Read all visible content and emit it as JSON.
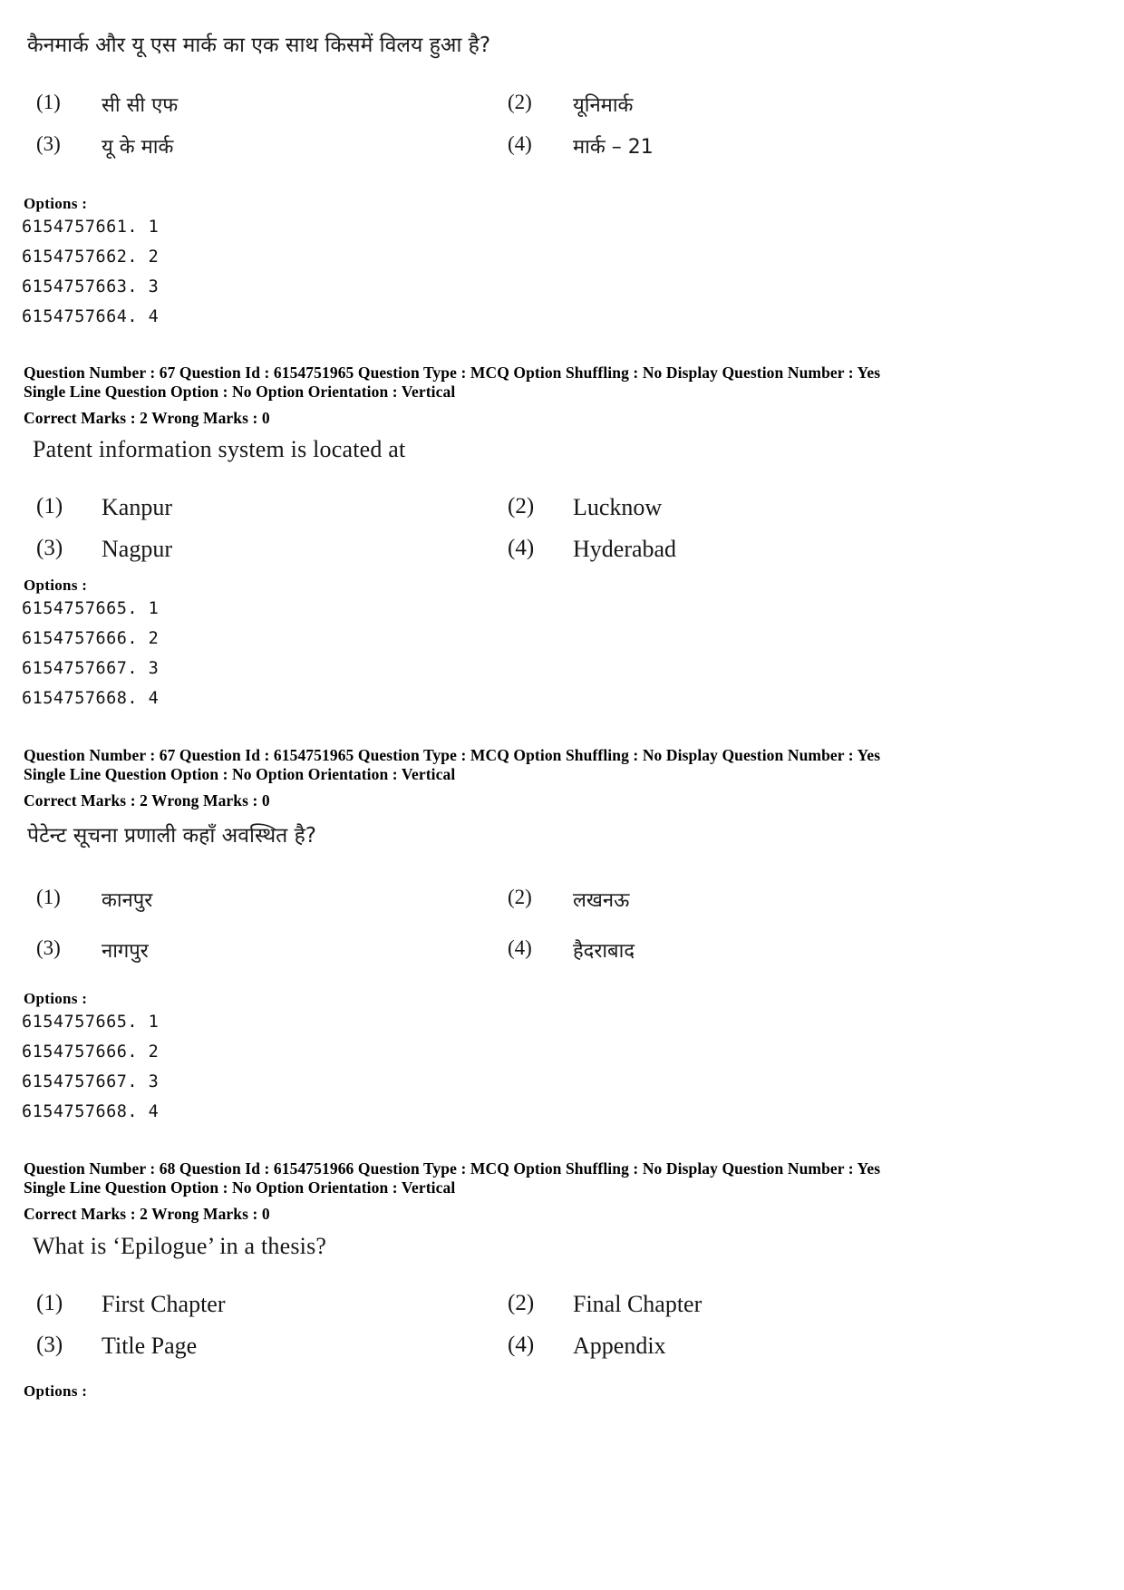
{
  "page": {
    "labels": {
      "options_header": "Options :"
    }
  },
  "sections": [
    {
      "id": "q66-hindi-body",
      "question_text_hi": "कैनमार्क और यू एस मार्क का एक साथ किसमें विलय हुआ है?",
      "options": [
        {
          "num": "(1)",
          "label": "सी सी एफ"
        },
        {
          "num": "(2)",
          "label": "यूनिमार्क"
        },
        {
          "num": "(3)",
          "label": "यू के मार्क"
        },
        {
          "num": "(4)",
          "label": "मार्क – 21"
        }
      ],
      "option_ids": [
        "6154757661. 1",
        "6154757662. 2",
        "6154757663. 3",
        "6154757664. 4"
      ]
    },
    {
      "id": "q67-english",
      "meta_line1": "Question Number : 67  Question Id : 6154751965  Question Type : MCQ  Option Shuffling : No  Display Question Number : Yes",
      "meta_line2": "Single Line Question Option : No  Option Orientation : Vertical",
      "meta_line3": "Correct Marks : 2  Wrong Marks : 0",
      "question_text_en": "Patent information system is located at",
      "options": [
        {
          "num": "(1)",
          "label": "Kanpur"
        },
        {
          "num": "(2)",
          "label": "Lucknow"
        },
        {
          "num": "(3)",
          "label": "Nagpur"
        },
        {
          "num": "(4)",
          "label": "Hyderabad"
        }
      ],
      "option_ids": [
        "6154757665. 1",
        "6154757666. 2",
        "6154757667. 3",
        "6154757668. 4"
      ]
    },
    {
      "id": "q67-hindi",
      "meta_line1": "Question Number : 67  Question Id : 6154751965  Question Type : MCQ  Option Shuffling : No  Display Question Number : Yes",
      "meta_line2": "Single Line Question Option : No  Option Orientation : Vertical",
      "meta_line3": "Correct Marks : 2  Wrong Marks : 0",
      "question_text_hi": "पेटेन्ट सूचना प्रणाली कहाँ अवस्थित है?",
      "options": [
        {
          "num": "(1)",
          "label": "कानपुर"
        },
        {
          "num": "(2)",
          "label": "लखनऊ"
        },
        {
          "num": "(3)",
          "label": "नागपुर"
        },
        {
          "num": "(4)",
          "label": "हैदराबाद"
        }
      ],
      "option_ids": [
        "6154757665. 1",
        "6154757666. 2",
        "6154757667. 3",
        "6154757668. 4"
      ]
    },
    {
      "id": "q68-english",
      "meta_line1": "Question Number : 68  Question Id : 6154751966  Question Type : MCQ  Option Shuffling : No  Display Question Number : Yes",
      "meta_line2": "Single Line Question Option : No  Option Orientation : Vertical",
      "meta_line3": "Correct Marks : 2  Wrong Marks : 0",
      "question_text_en": "What is ‘Epilogue’ in a thesis?",
      "options": [
        {
          "num": "(1)",
          "label": "First Chapter"
        },
        {
          "num": "(2)",
          "label": "Final Chapter"
        },
        {
          "num": "(3)",
          "label": "Title Page"
        },
        {
          "num": "(4)",
          "label": "Appendix"
        }
      ],
      "option_ids": []
    }
  ]
}
